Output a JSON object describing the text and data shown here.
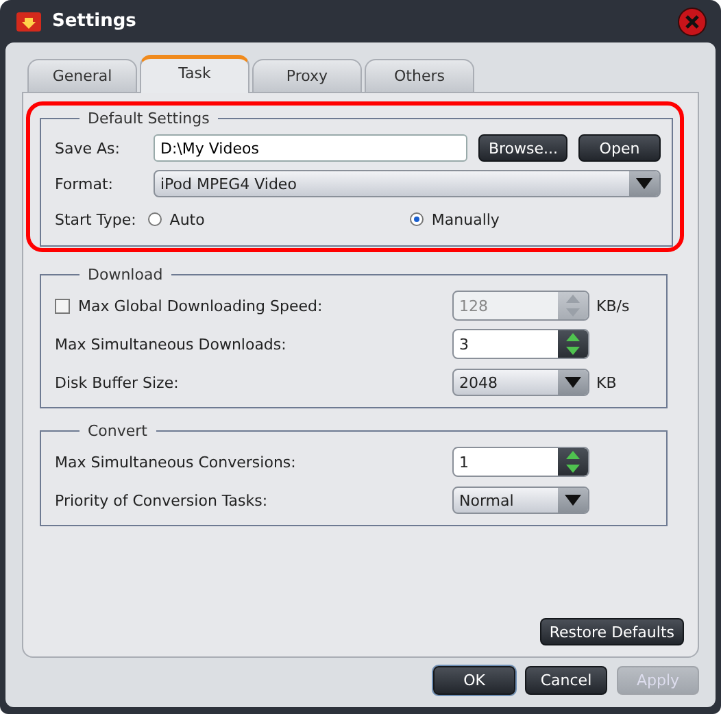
{
  "window": {
    "title": "Settings"
  },
  "tabs": [
    {
      "label": "General",
      "selected": false
    },
    {
      "label": "Task",
      "selected": true
    },
    {
      "label": "Proxy",
      "selected": false
    },
    {
      "label": "Others",
      "selected": false
    }
  ],
  "default_settings": {
    "legend": "Default Settings",
    "highlighted": true,
    "save_as": {
      "label": "Save As:",
      "value": "D:\\My Videos"
    },
    "browse": "Browse...",
    "open": "Open",
    "format": {
      "label": "Format:",
      "value": "iPod MPEG4 Video"
    },
    "start_type": {
      "label": "Start Type:",
      "options": [
        {
          "label": "Auto",
          "selected": false
        },
        {
          "label": "Manually",
          "selected": true
        }
      ]
    }
  },
  "download": {
    "legend": "Download",
    "rows": [
      {
        "kind": "spin",
        "label": "Max Global Downloading Speed:",
        "checked": false,
        "disabled": true,
        "value": "128",
        "unit": "KB/s"
      },
      {
        "kind": "spin",
        "label": "Max Simultaneous Downloads:",
        "disabled": false,
        "value": "3"
      },
      {
        "kind": "select",
        "label": "Disk Buffer Size:",
        "value": "2048",
        "unit": "KB"
      }
    ]
  },
  "convert": {
    "legend": "Convert",
    "rows": [
      {
        "kind": "spin",
        "label": "Max Simultaneous Conversions:",
        "disabled": false,
        "value": "1"
      },
      {
        "kind": "select",
        "label": "Priority of Conversion Tasks:",
        "value": "Normal"
      }
    ]
  },
  "restore_button": "Restore Defaults",
  "buttons": [
    {
      "label": "OK",
      "disabled": false,
      "focused": true
    },
    {
      "label": "Cancel",
      "disabled": false,
      "focused": false
    },
    {
      "label": "Apply",
      "disabled": true,
      "focused": false
    }
  ]
}
